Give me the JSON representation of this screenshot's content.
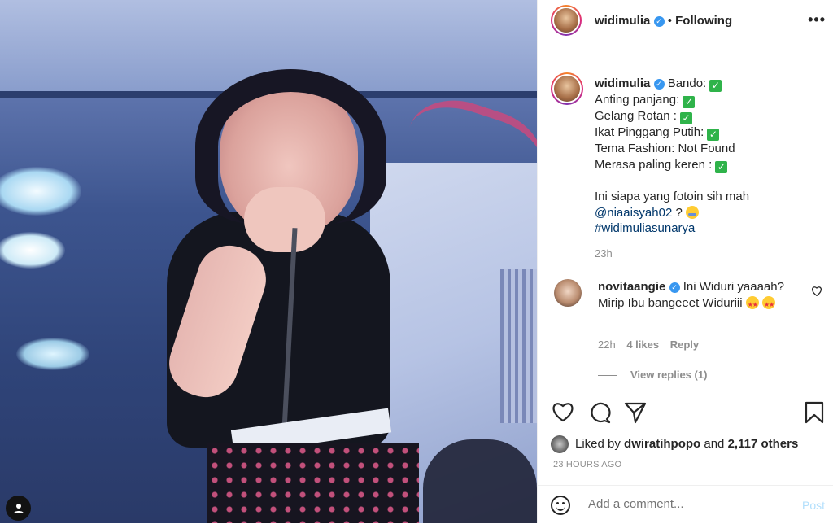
{
  "post": {
    "username": "widimulia",
    "follow_status": "Following",
    "more_label": "•••",
    "bullet": "•"
  },
  "caption": {
    "username": "widimulia",
    "lines": [
      "Bando:",
      "Anting panjang:",
      "Gelang Rotan :",
      "Ikat Pinggang Putih:",
      "Tema Fashion: Not Found",
      "Merasa paling keren :"
    ],
    "line_question": "Ini siapa yang fotoin sih mah",
    "mention": "@niaaisyah02",
    "mention_suffix": " ? ",
    "hashtag": "#widimuliasunarya",
    "time": "23h",
    "check_glyph": "✓"
  },
  "comment": {
    "username": "novitaangie",
    "text": "Ini Widuri yaaaah? Mirip Ibu bangeeet Widuriii",
    "time": "22h",
    "likes": "4 likes",
    "reply": "Reply",
    "view_replies": "View replies (1)"
  },
  "likes": {
    "prefix": "Liked by",
    "user": "dwiratihpopo",
    "middle": "and",
    "count": "2,117 others"
  },
  "timestamp": "23 HOURS AGO",
  "add_comment": {
    "placeholder": "Add a comment...",
    "post_label": "Post"
  },
  "icons": {
    "heart": "heart-icon",
    "comment": "comment-icon",
    "share": "share-icon",
    "bookmark": "bookmark-icon"
  },
  "colors": {
    "verified": "#3897f0",
    "link": "#00376b",
    "muted": "#8e8e8e",
    "post_disabled": "#b2dffc"
  }
}
